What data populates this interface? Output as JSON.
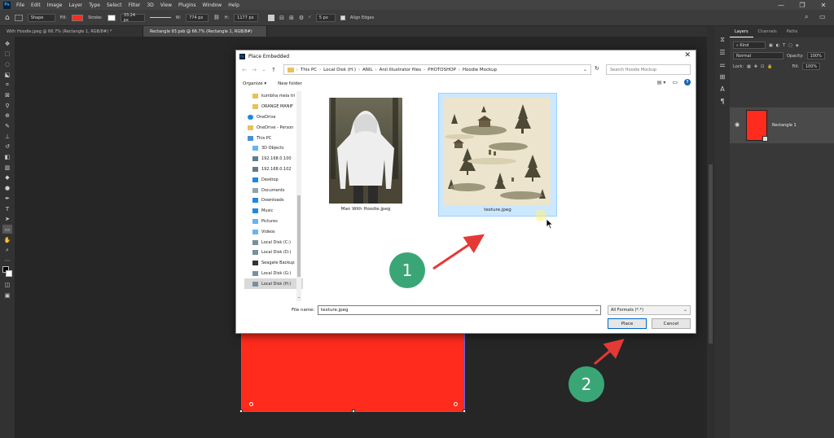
{
  "menubar": {
    "logo": "Ps",
    "items": [
      "File",
      "Edit",
      "Image",
      "Layer",
      "Type",
      "Select",
      "Filter",
      "3D",
      "View",
      "Plugins",
      "Window",
      "Help"
    ],
    "minimize": "—",
    "maximize": "❐",
    "close": "✕"
  },
  "options": {
    "tool_mode": "Shape",
    "fill_label": "Fill:",
    "stroke_label": "Stroke:",
    "stroke_width": "33.24 px",
    "w_label": "W:",
    "w_value": "774 px",
    "h_label": "H:",
    "h_value": "1177 px",
    "radius": "5 px",
    "align_edges": "Align Edges",
    "fill_color": "#ff2b1c"
  },
  "tabs": [
    {
      "label": "With Hoodie.jpeg @ 66.7% (Rectangle 1, RGB/8#) *",
      "active": false
    },
    {
      "label": "Rectangle 93.psb @ 66.7% (Rectangle 1, RGB/8#)",
      "active": true
    }
  ],
  "layers_panel": {
    "tabs": [
      "Layers",
      "Channels",
      "Paths"
    ],
    "kind_filter": "Kind",
    "blend_mode": "Normal",
    "opacity_label": "Opacity:",
    "opacity_value": "100%",
    "lock_label": "Lock:",
    "fill_label": "Fill:",
    "fill_value": "100%",
    "layer_name": "Rectangle 1"
  },
  "dialog": {
    "title": "Place Embedded",
    "close": "✕",
    "breadcrumb": [
      "This PC",
      "Local Disk (H:)",
      "ANIL",
      "Anil illustrator files",
      "PHOTOSHOP",
      "Hoodie Mockup"
    ],
    "search_placeholder": "Search Hoodie Mockup",
    "organize": "Organize ▾",
    "new_folder": "New folder",
    "nav_items": [
      {
        "label": "kumbha mela tri",
        "icon": "folder-icon",
        "indent": true
      },
      {
        "label": "ORANGE MANIF",
        "icon": "folder-icon",
        "indent": true
      },
      {
        "label": "OneDrive",
        "icon": "cloud-icon",
        "indent": false
      },
      {
        "label": "OneDrive - Person",
        "icon": "folder-icon",
        "indent": false
      },
      {
        "label": "This PC",
        "icon": "computer-icon",
        "indent": false
      },
      {
        "label": "3D Objects",
        "icon": "cube-icon",
        "indent": true
      },
      {
        "label": "192.168.0.100",
        "icon": "network-drive-icon",
        "indent": true
      },
      {
        "label": "192.168.0.102",
        "icon": "network-drive-icon",
        "indent": true
      },
      {
        "label": "Desktop",
        "icon": "desktop-icon",
        "indent": true
      },
      {
        "label": "Documents",
        "icon": "documents-icon",
        "indent": true
      },
      {
        "label": "Downloads",
        "icon": "download-icon",
        "indent": true
      },
      {
        "label": "Music",
        "icon": "music-icon",
        "indent": true
      },
      {
        "label": "Pictures",
        "icon": "pictures-icon",
        "indent": true
      },
      {
        "label": "Videos",
        "icon": "video-icon",
        "indent": true
      },
      {
        "label": "Local Disk (C:)",
        "icon": "drive-icon",
        "indent": true
      },
      {
        "label": "Local Disk (D:)",
        "icon": "drive-icon",
        "indent": true
      },
      {
        "label": "Seagate Backup",
        "icon": "external-drive-icon",
        "indent": true
      },
      {
        "label": "Local Disk (G:)",
        "icon": "drive-icon",
        "indent": true
      },
      {
        "label": "Local Disk (H:)",
        "icon": "drive-icon",
        "indent": true,
        "selected": true
      }
    ],
    "files": [
      {
        "name": "Man With Hoodie.jpeg",
        "selected": false
      },
      {
        "name": "texture.jpeg",
        "selected": true
      }
    ],
    "filename_label": "File name:",
    "filename_value": "texture.jpeg",
    "format": "All Formats (*.*)",
    "place_button": "Place",
    "cancel_button": "Cancel"
  },
  "annotations": {
    "step1": "1",
    "step2": "2",
    "badge_color": "#3aa676",
    "arrow_color": "#e53935"
  }
}
